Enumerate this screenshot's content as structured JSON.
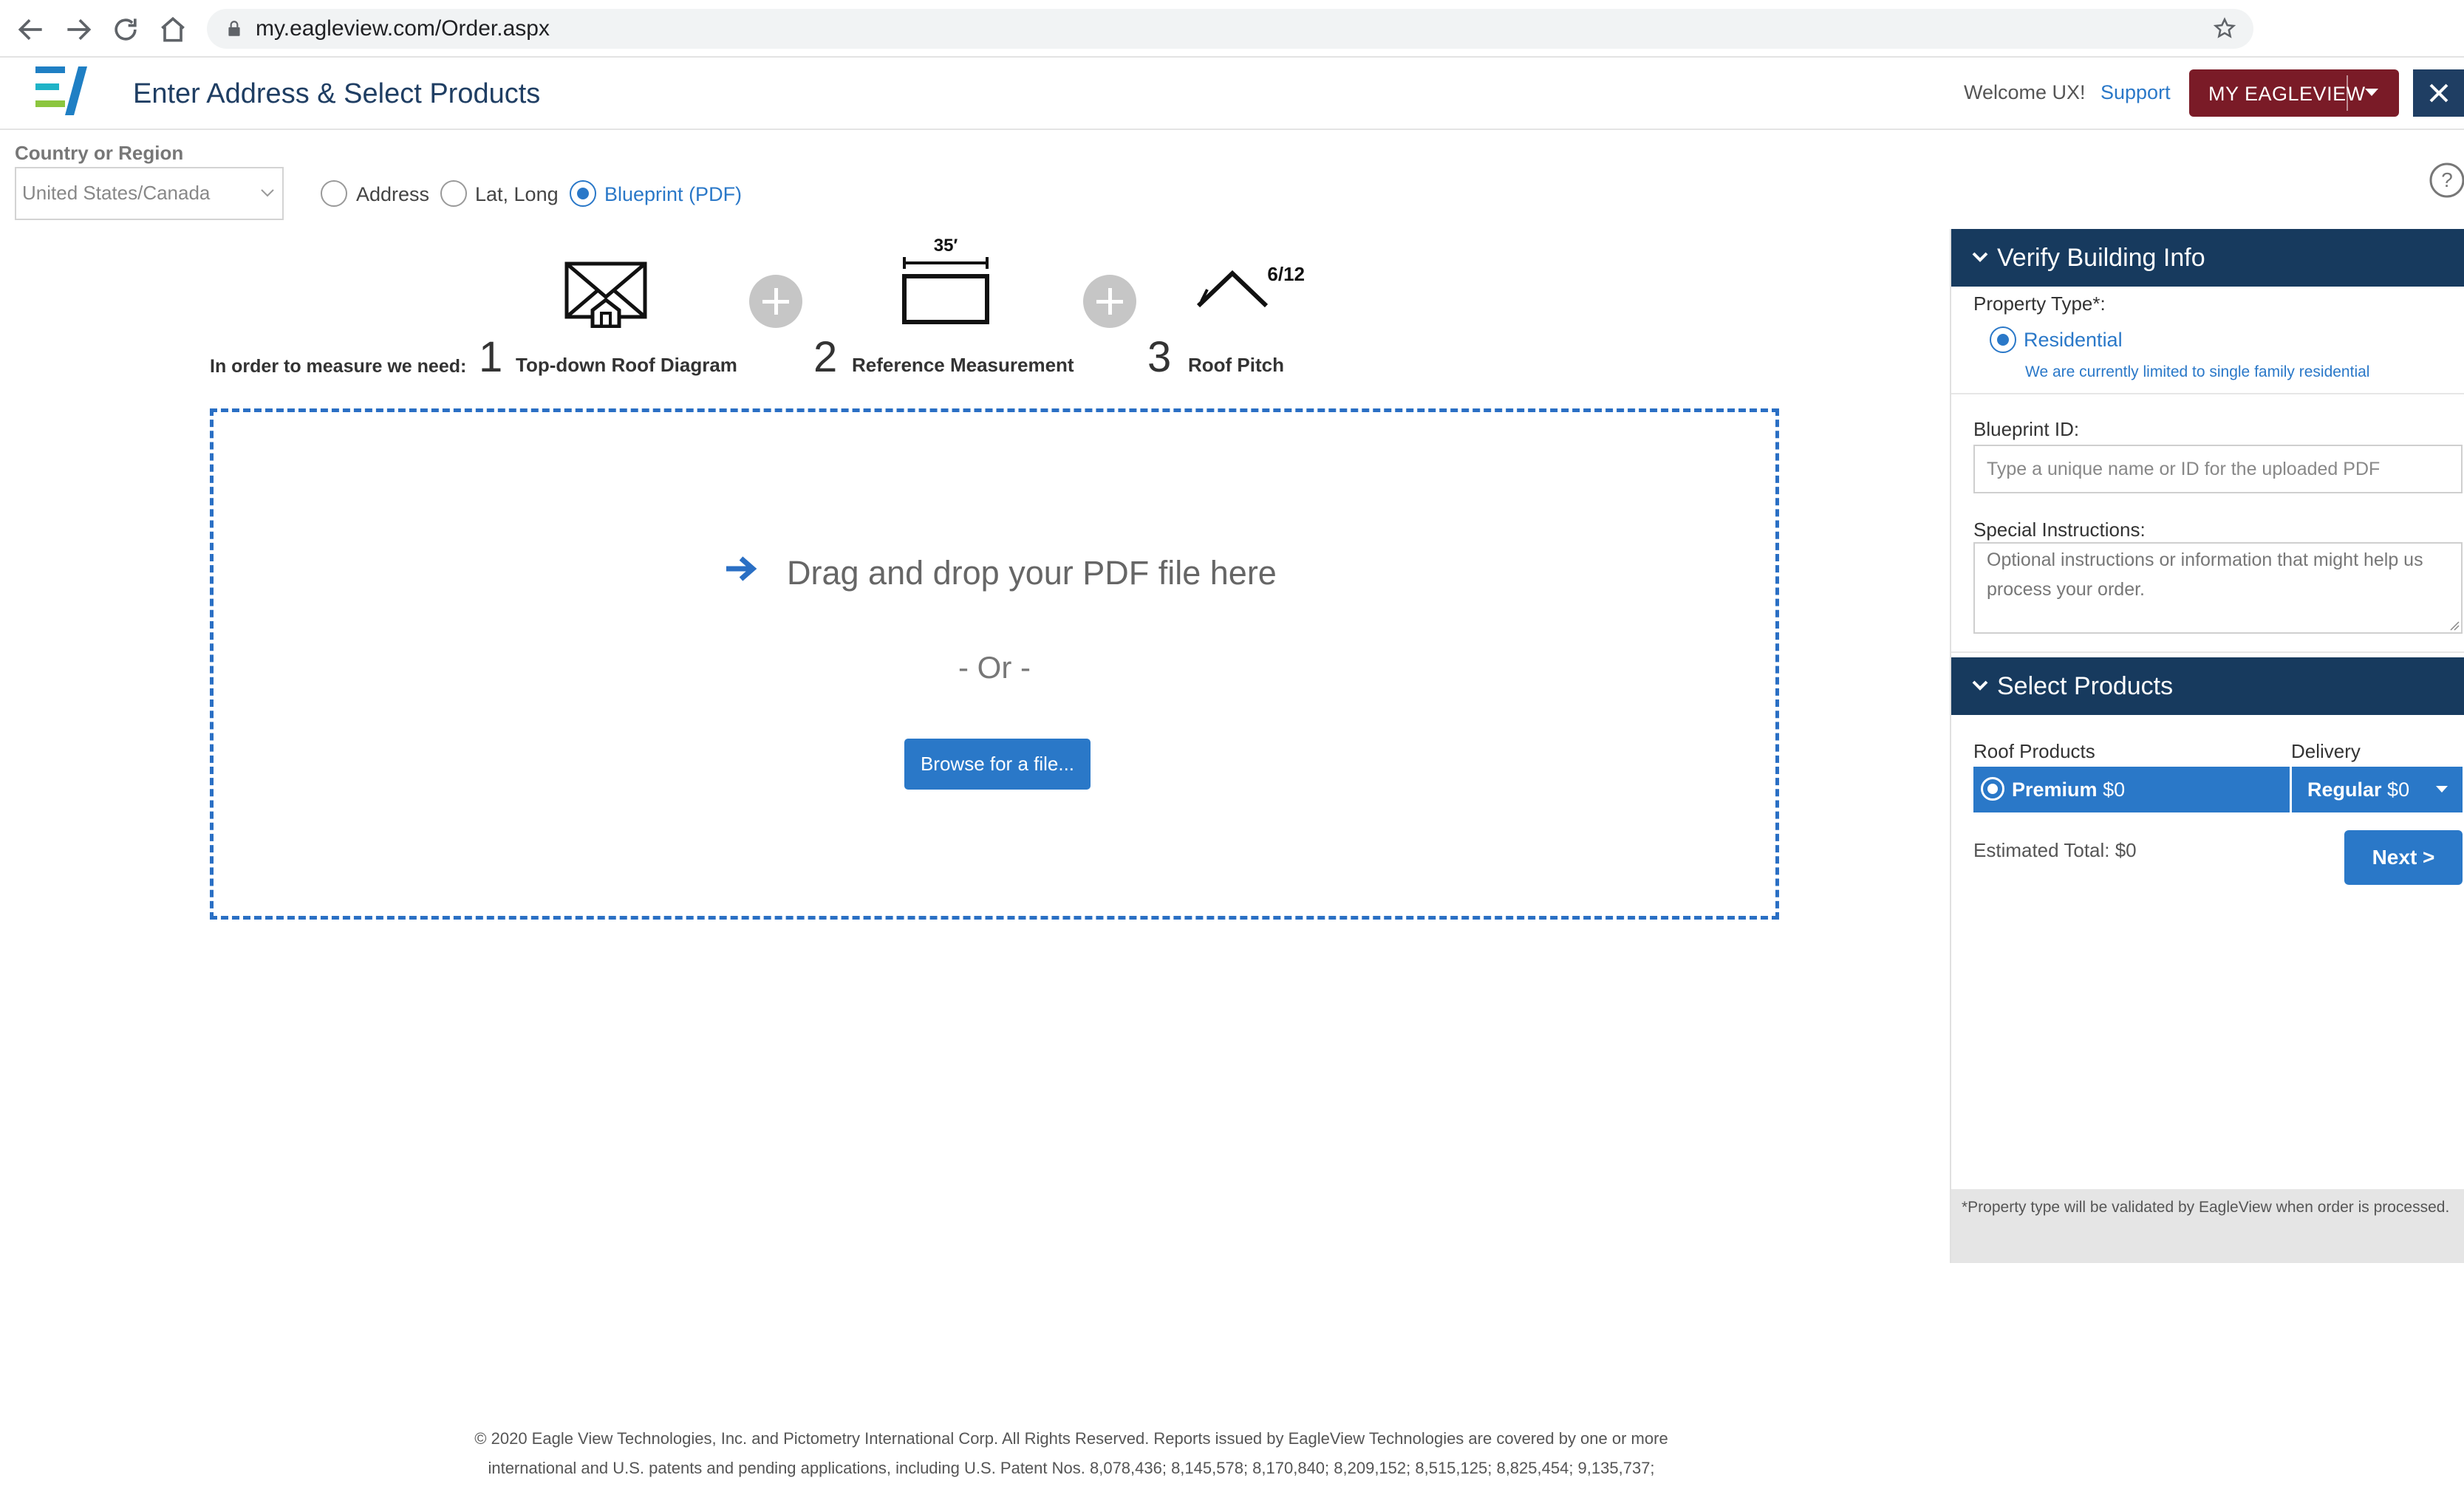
{
  "browser": {
    "url": "my.eagleview.com/Order.aspx"
  },
  "header": {
    "title": "Enter Address & Select Products",
    "welcome": "Welcome UX!",
    "support": "Support",
    "my_eagleview": "MY EAGLEVIEW"
  },
  "location": {
    "country_label": "Country or Region",
    "country_value": "United States/Canada",
    "modes": [
      {
        "label": "Address",
        "selected": false
      },
      {
        "label": "Lat, Long",
        "selected": false
      },
      {
        "label": "Blueprint (PDF)",
        "selected": true
      }
    ]
  },
  "requirements": {
    "intro": "In order to measure we need:",
    "steps": [
      {
        "num": "1",
        "label": "Top-down Roof Diagram",
        "icon": "roof-diagram-icon"
      },
      {
        "num": "2",
        "label": "Reference Measurement",
        "icon": "reference-measurement-icon",
        "icon_text": "35′"
      },
      {
        "num": "3",
        "label": "Roof Pitch",
        "icon": "roof-pitch-icon",
        "icon_text": "6/12"
      }
    ]
  },
  "dropzone": {
    "drag_text": "Drag and drop your PDF file here",
    "or_text": "- Or -",
    "browse_label": "Browse for a file..."
  },
  "verify": {
    "title": "Verify Building Info",
    "property_type_label": "Property Type*:",
    "property_type_value": "Residential",
    "property_note": "We are currently limited to single family residential",
    "blueprint_label": "Blueprint ID:",
    "blueprint_placeholder": "Type a unique name or ID for the uploaded PDF",
    "instructions_label": "Special Instructions:",
    "instructions_placeholder": "Optional instructions or information that might help us process your order."
  },
  "products": {
    "title": "Select Products",
    "roof_products_label": "Roof Products",
    "delivery_label": "Delivery",
    "product_name": "Premium",
    "product_price": "$0",
    "delivery_name": "Regular",
    "delivery_price": "$0",
    "estimated_total": "Estimated Total: $0",
    "next_label": "Next >",
    "footnote": "*Property type will be validated by EagleView when order is processed."
  },
  "footer": {
    "line1": "© 2020 Eagle View Technologies, Inc. and Pictometry International Corp. All Rights Reserved. Reports issued by EagleView Technologies are covered by one or more",
    "line2": "international and U.S. patents and pending applications, including U.S. Patent Nos. 8,078,436; 8,145,578; 8,170,840; 8,209,152; 8,515,125; 8,825,454; 9,135,737;"
  },
  "colors": {
    "navy": "#173a5e",
    "accent_blue": "#2a78c8",
    "maroon": "#7a1b27"
  }
}
